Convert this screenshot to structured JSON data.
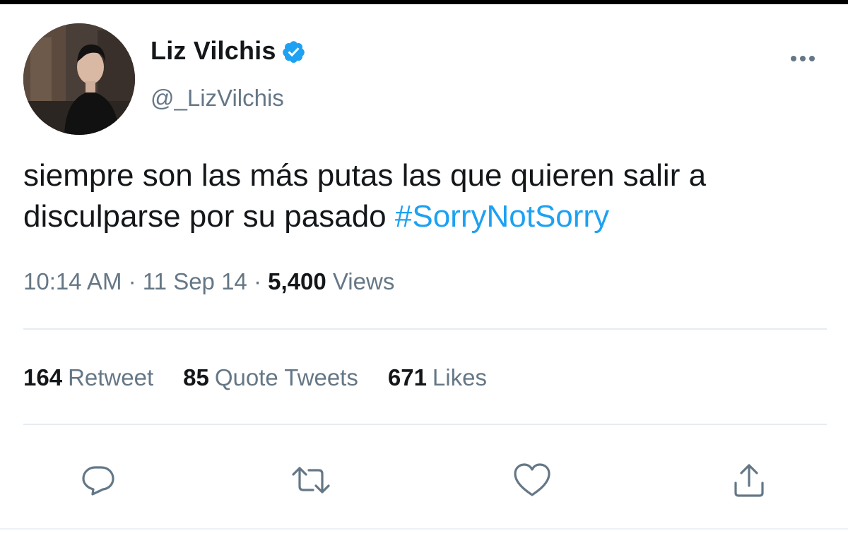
{
  "tweet": {
    "author": {
      "display_name": "Liz Vilchis",
      "handle": "@_LizVilchis",
      "verified": true
    },
    "text": "siempre son las más putas las que quieren salir a disculparse por su pasado ",
    "hashtag": "#SorryNotSorry",
    "meta": {
      "time": "10:14 AM",
      "separator": " · ",
      "date": "11 Sep 14",
      "views_count": "5,400",
      "views_label": "Views"
    },
    "stats": {
      "retweets_count": "164",
      "retweets_label": "Retweet",
      "quotes_count": "85",
      "quotes_label": "Quote Tweets",
      "likes_count": "671",
      "likes_label": "Likes"
    }
  },
  "icons": {
    "verified": "verified-badge-icon",
    "more": "more-options-icon",
    "reply": "reply-icon",
    "retweet": "retweet-icon",
    "like": "like-icon",
    "share": "share-icon"
  },
  "colors": {
    "link": "#1da1f2",
    "text": "#14171a",
    "muted": "#657786",
    "divider": "#e6ecf0"
  }
}
